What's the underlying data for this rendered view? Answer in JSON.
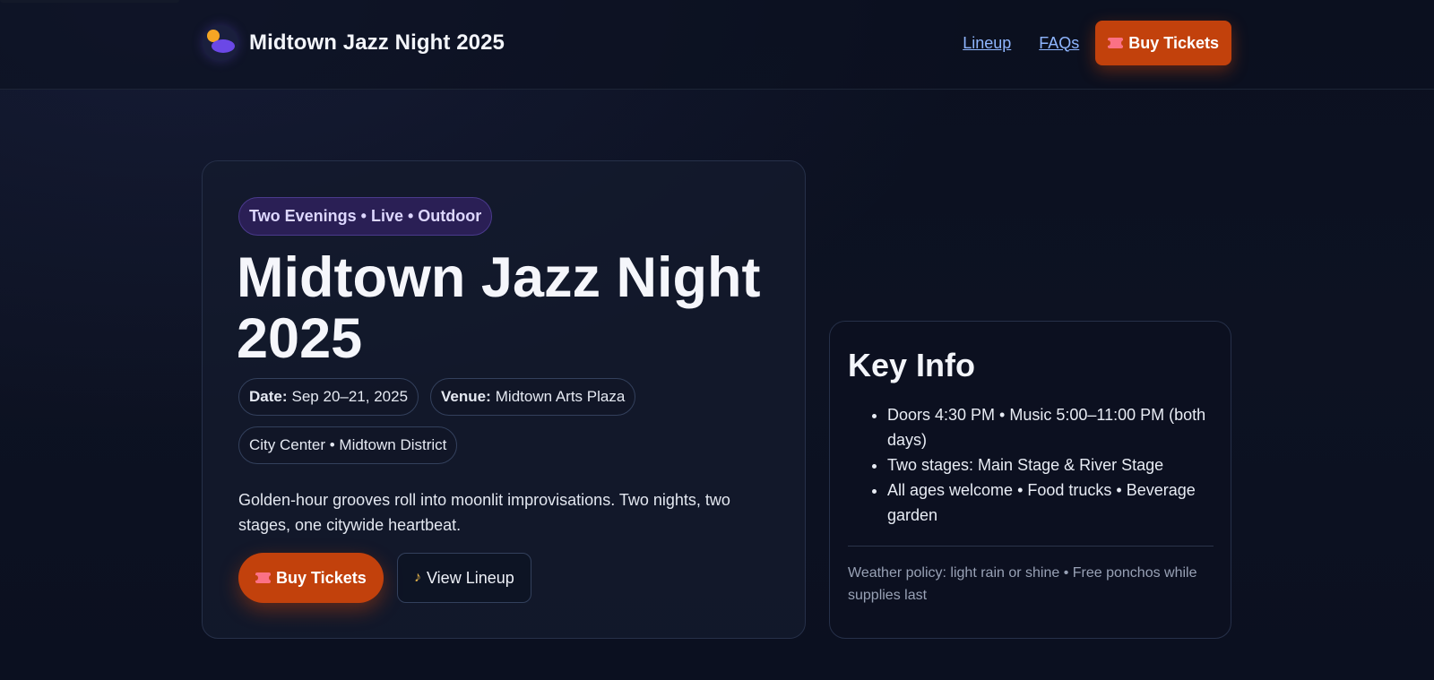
{
  "header": {
    "brand_title": "Midtown Jazz Night 2025",
    "nav": [
      {
        "label": "Lineup"
      },
      {
        "label": "FAQs"
      }
    ],
    "buy_label": "Buy Tickets"
  },
  "hero": {
    "tagline": "Two Evenings • Live • Outdoor",
    "title": "Midtown Jazz Night 2025",
    "date_label": "Date:",
    "date_value": "Sep 20–21, 2025",
    "venue_label": "Venue:",
    "venue_value": "Midtown Arts Plaza",
    "location": "City Center • Midtown District",
    "description": "Golden-hour grooves roll into moonlit improvisations. Two nights, two stages, one citywide heartbeat.",
    "buy_label": "Buy Tickets",
    "lineup_label": "View Lineup"
  },
  "key_info": {
    "title": "Key Info",
    "items": [
      "Doors 4:30 PM • Music 5:00–11:00 PM (both days)",
      "Two stages: Main Stage & River Stage",
      "All ages welcome • Food trucks • Beverage garden"
    ],
    "note": "Weather policy: light rain or shine • Free ponchos while supplies last"
  },
  "icons": {
    "brand": "sun-moon-logo-icon",
    "ticket": "ticket-icon",
    "saxophone": "saxophone-icon"
  },
  "colors": {
    "accent": "#c2410c",
    "link": "#8fb6ff",
    "tagline_bg": "#2a1f55",
    "background": "#0c1120"
  }
}
